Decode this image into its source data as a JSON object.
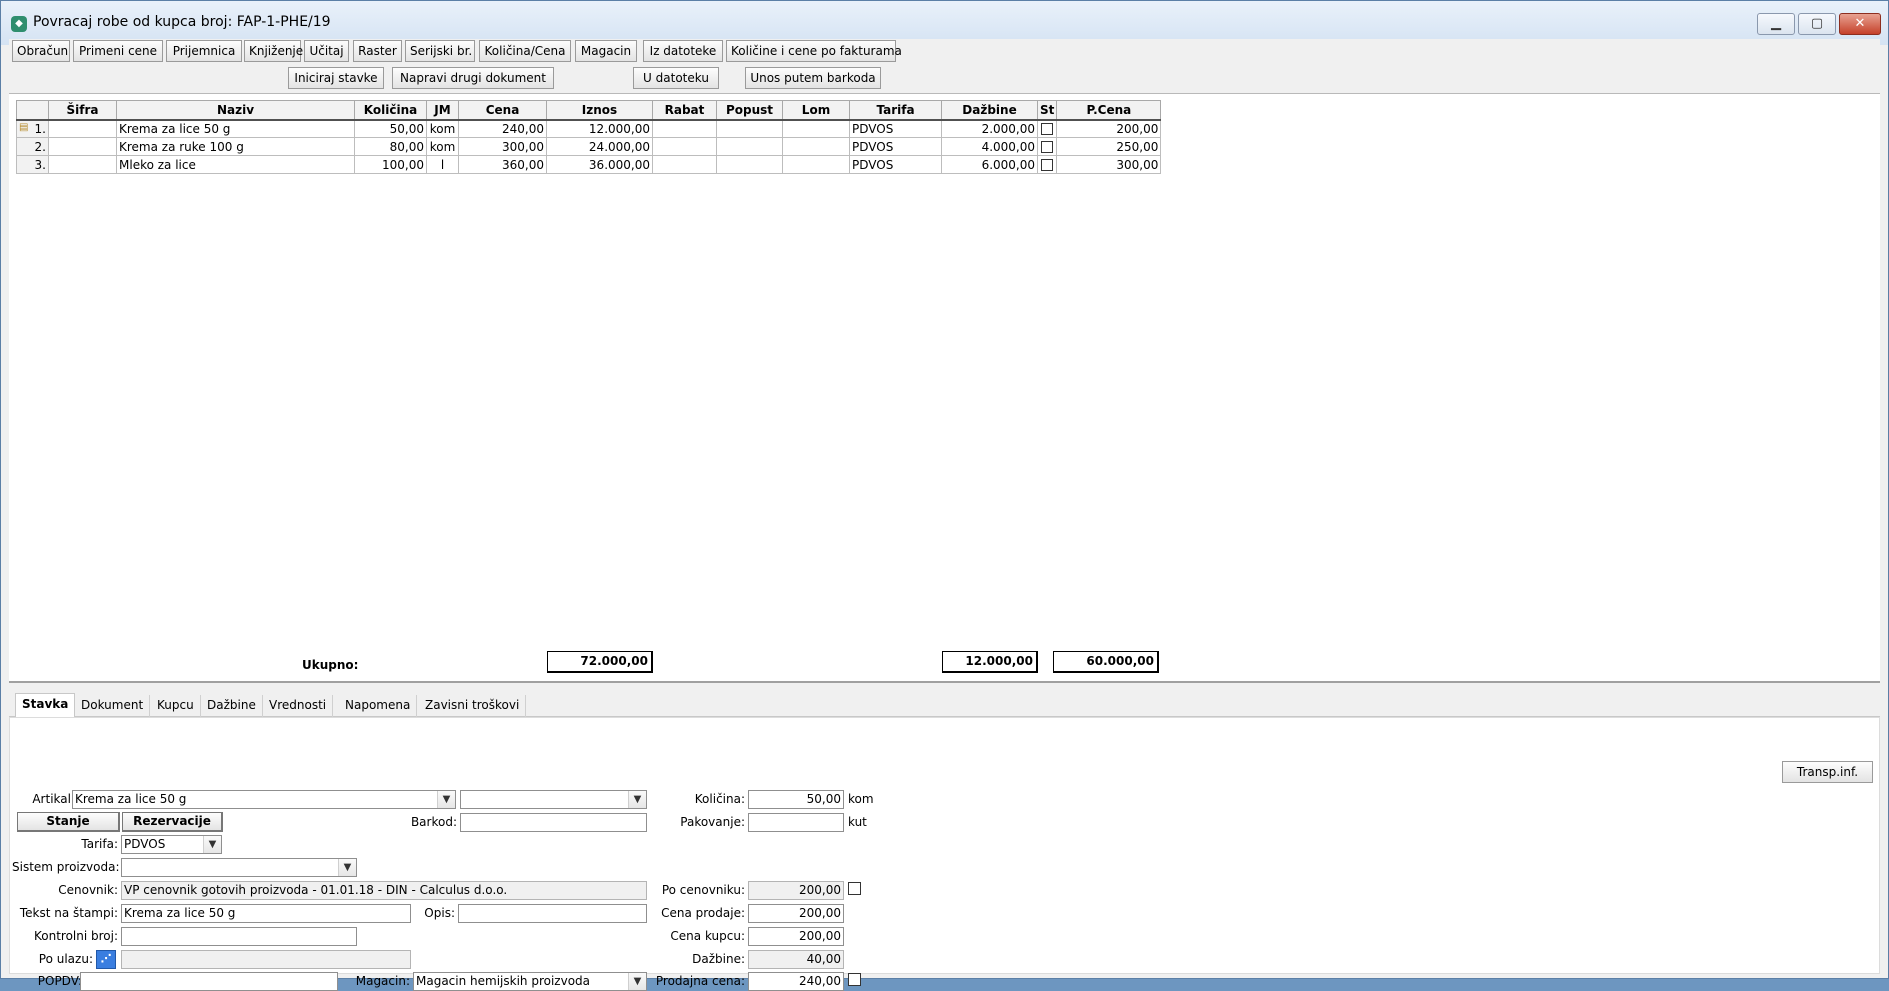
{
  "window": {
    "title": "Povracaj robe od kupca broj: FAP-1-PHE/19"
  },
  "window_controls": {
    "minimize": "▁",
    "maximize": "▢",
    "close": "✕"
  },
  "toolbar": {
    "row1": [
      "Obračun",
      "Primeni cene",
      "Prijemnica",
      "Knjiženje",
      "Učitaj",
      "Raster",
      "Serijski br.",
      "Količina/Cena",
      "Magacin",
      "Iz datoteke",
      "Količine i cene po fakturama"
    ],
    "row2": [
      "Iniciraj stavke",
      "Napravi drugi dokument",
      "U datoteku",
      "Unos putem barkoda"
    ]
  },
  "grid": {
    "columns": [
      "",
      "Šifra",
      "Naziv",
      "Količina",
      "JM",
      "Cena",
      "Iznos",
      "Rabat",
      "Popust",
      "Lom",
      "Tarifa",
      "Dažbine",
      "St",
      "P.Cena"
    ],
    "rows": [
      {
        "no": "1.",
        "sifra": "",
        "naziv": "Krema za lice 50 g",
        "kolicina": "50,00",
        "jm": "kom",
        "cena": "240,00",
        "iznos": "12.000,00",
        "rabat": "",
        "popust": "",
        "lom": "",
        "tarifa": "PDVOS",
        "dazbine": "2.000,00",
        "pcena": "200,00"
      },
      {
        "no": "2.",
        "sifra": "",
        "naziv": "Krema za ruke 100 g",
        "kolicina": "80,00",
        "jm": "kom",
        "cena": "300,00",
        "iznos": "24.000,00",
        "rabat": "",
        "popust": "",
        "lom": "",
        "tarifa": "PDVOS",
        "dazbine": "4.000,00",
        "pcena": "250,00"
      },
      {
        "no": "3.",
        "sifra": "",
        "naziv": "Mleko za lice",
        "kolicina": "100,00",
        "jm": "l",
        "cena": "360,00",
        "iznos": "36.000,00",
        "rabat": "",
        "popust": "",
        "lom": "",
        "tarifa": "PDVOS",
        "dazbine": "6.000,00",
        "pcena": "300,00"
      }
    ],
    "totals": {
      "label": "Ukupno:",
      "iznos": "72.000,00",
      "dazbine": "12.000,00",
      "pcena": "60.000,00"
    }
  },
  "tabs": [
    "Stavka",
    "Dokument",
    "Kupcu",
    "Dažbine",
    "Vrednosti",
    "Napomena",
    "Zavisni troškovi"
  ],
  "form": {
    "transp_btn": "Transp.inf.",
    "artikal_label": "Artikal:",
    "artikal_value": "Krema za lice 50 g",
    "artikal2_value": "",
    "stanje_btn": "Stanje",
    "rezervacije_btn": "Rezervacije",
    "barkod_label": "Barkod:",
    "barkod_value": "",
    "tarifa_label": "Tarifa:",
    "tarifa_value": "PDVOS",
    "sistem_label": "Sistem proizvoda:",
    "sistem_value": "",
    "cenovnik_label": "Cenovnik:",
    "cenovnik_value": "VP cenovnik gotovih proizvoda - 01.01.18 - DIN - Calculus d.o.o.",
    "tekst_label": "Tekst na štampi:",
    "tekst_value": "Krema za lice 50 g",
    "opis_label": "Opis:",
    "opis_value": "",
    "kontrolni_label": "Kontrolni broj:",
    "kontrolni_value": "",
    "po_ulazu_label": "Po ulazu:",
    "po_ulazu_value": "",
    "popdv_label": "POPDV:",
    "popdv_value": "",
    "magacin_label": "Magacin:",
    "magacin_value": "Magacin hemijskih proizvoda",
    "kolicina_label": "Količina:",
    "kolicina_value": "50,00",
    "kolicina_unit": "kom",
    "pakovanje_label": "Pakovanje:",
    "pakovanje_value": "",
    "pakovanje_unit": "kut",
    "po_cenovniku_label": "Po cenovniku:",
    "po_cenovniku_value": "200,00",
    "cena_prodaje_label": "Cena prodaje:",
    "cena_prodaje_value": "200,00",
    "cena_kupcu_label": "Cena kupcu:",
    "cena_kupcu_value": "200,00",
    "dazbine_label": "Dažbine:",
    "dazbine_value": "40,00",
    "prodajna_label": "Prodajna cena:",
    "prodajna_value": "240,00"
  }
}
